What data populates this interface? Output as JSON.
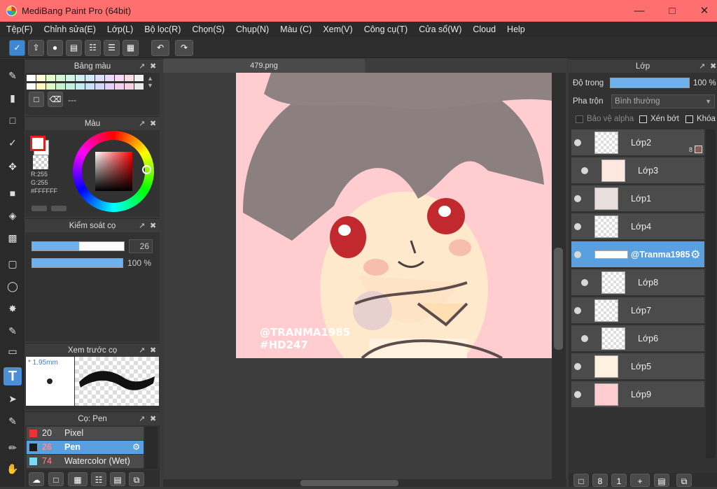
{
  "window": {
    "title": "MediBang Paint Pro (64bit)"
  },
  "menu": [
    "Tệp(F)",
    "Chỉnh sửa(E)",
    "Lớp(L)",
    "Bộ lọc(R)",
    "Chọn(S)",
    "Chụp(N)",
    "Màu (C)",
    "Xem(V)",
    "Công cụ(T)",
    "Cửa sổ(W)",
    "Cloud",
    "Help"
  ],
  "panels": {
    "palette": {
      "title": "Bảng màu",
      "value": "---"
    },
    "color": {
      "title": "Màu",
      "r": "R:255",
      "g": "G:255",
      "hex": "#FFFFFF"
    },
    "brush_control": {
      "title": "Kiểm soát cọ",
      "size": "26",
      "opacity": "100 %",
      "size_fraction": 0.51,
      "opacity_fraction": 1.0
    },
    "brush_preview": {
      "title": "Xem trước cọ",
      "size": "1.95mm"
    },
    "brush": {
      "title": "Cọ: Pen",
      "items": [
        {
          "size": "20",
          "name": "Pixel",
          "color": "#e83434"
        },
        {
          "size": "26",
          "name": "Pen",
          "color": "#1a1a1a"
        },
        {
          "size": "74",
          "name": "Watercolor (Wet)",
          "color": "#7fd8f5"
        }
      ]
    }
  },
  "canvas": {
    "tab": "479.png",
    "watermark1": "@TRANMA1985",
    "watermark2": "#HD247"
  },
  "layers_panel": {
    "title": "Lớp",
    "opacity_label": "Độ trong",
    "opacity_value": "100 %",
    "opacity_fraction": 1.0,
    "blend_label": "Pha trộn",
    "blend_value": "Bình thường",
    "protect_alpha": "Bảo vệ alpha",
    "clip": "Xén bớt",
    "lock": "Khóa",
    "layer2_badge": "8",
    "layers": [
      "Lớp2",
      "Lớp3",
      "Lớp1",
      "Lớp4",
      "@Tranma1985",
      "Lớp8",
      "Lớp7",
      "Lớp6",
      "Lớp5",
      "Lớp9"
    ]
  }
}
